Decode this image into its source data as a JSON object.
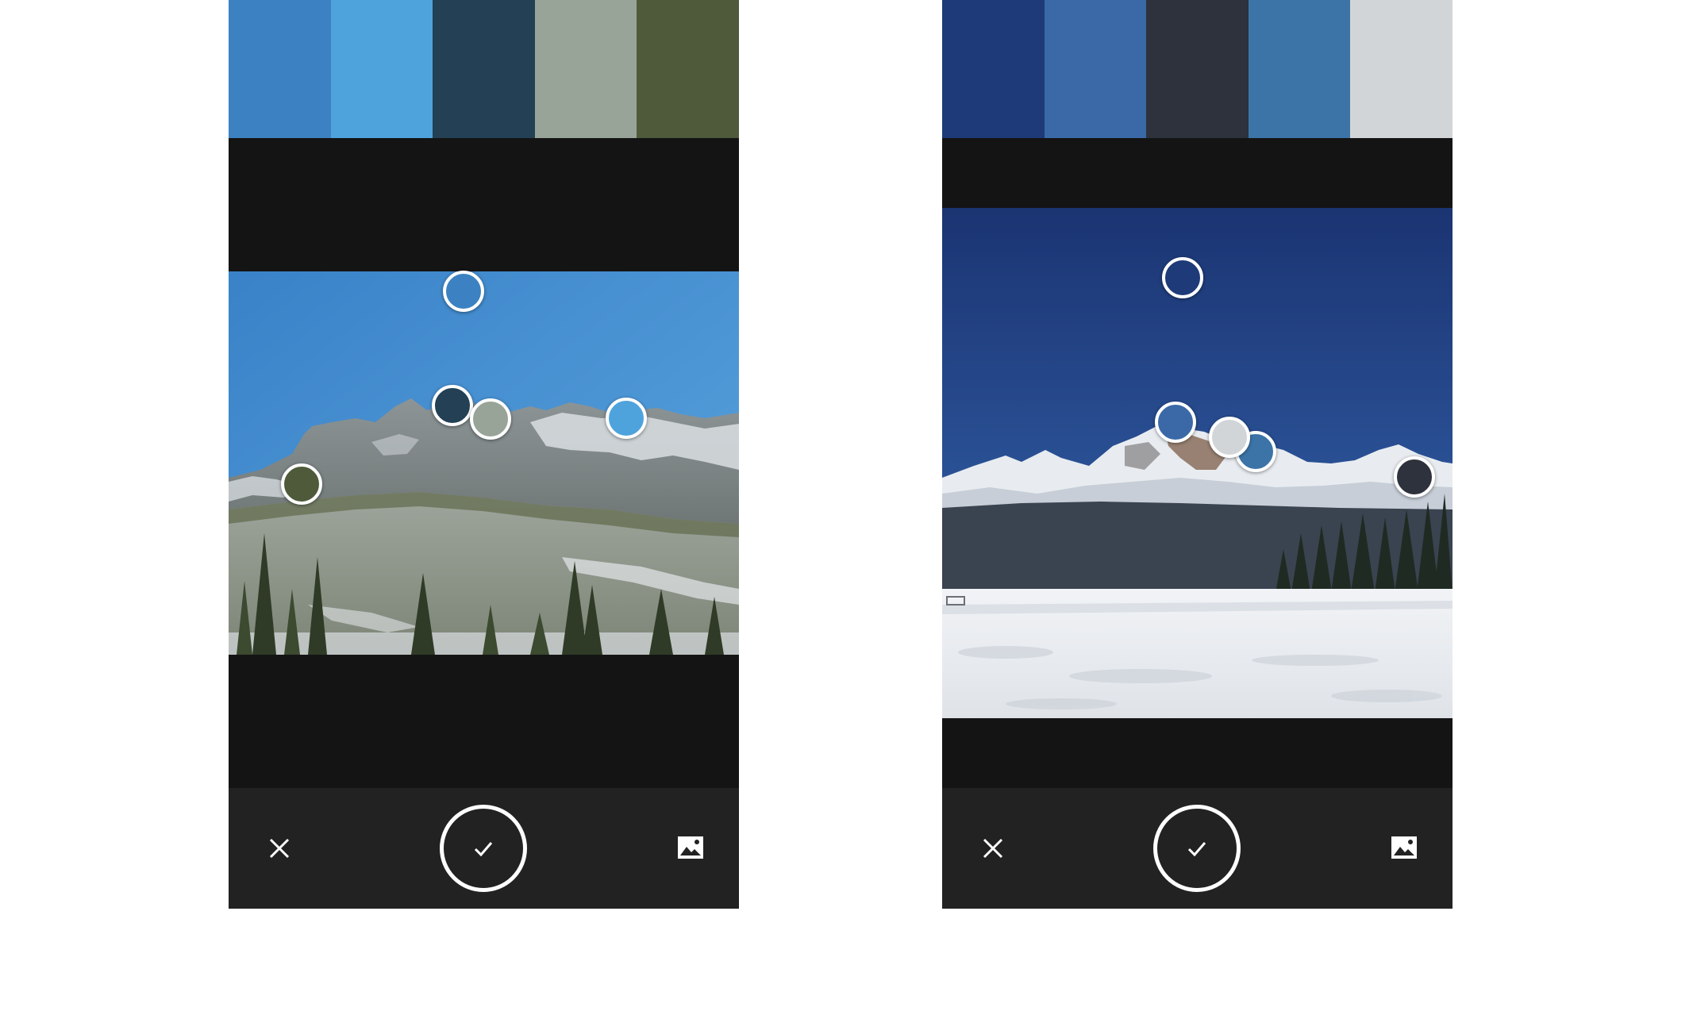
{
  "screens": [
    {
      "id": "left",
      "palette": [
        "#3c82c2",
        "#4fa3dc",
        "#234055",
        "#98a498",
        "#4e5a3a"
      ],
      "pickers": [
        {
          "color": "#3c82c2"
        },
        {
          "color": "#234055"
        },
        {
          "color": "#98a498"
        },
        {
          "color": "#4fa3dc"
        },
        {
          "color": "#4e5a3a"
        }
      ],
      "toolbar": {
        "close_icon": "close-icon",
        "confirm_icon": "check-icon",
        "gallery_icon": "image-icon"
      }
    },
    {
      "id": "right",
      "palette": [
        "#1e3a78",
        "#3b69a8",
        "#2d323c",
        "#3c74a8",
        "#d2d5d8"
      ],
      "pickers": [
        {
          "color": "#1e3a78"
        },
        {
          "color": "#3b69a8"
        },
        {
          "color": "#3c74a8"
        },
        {
          "color": "#d2d5d8"
        },
        {
          "color": "#2d323c"
        }
      ],
      "toolbar": {
        "close_icon": "close-icon",
        "confirm_icon": "check-icon",
        "gallery_icon": "image-icon"
      }
    }
  ]
}
